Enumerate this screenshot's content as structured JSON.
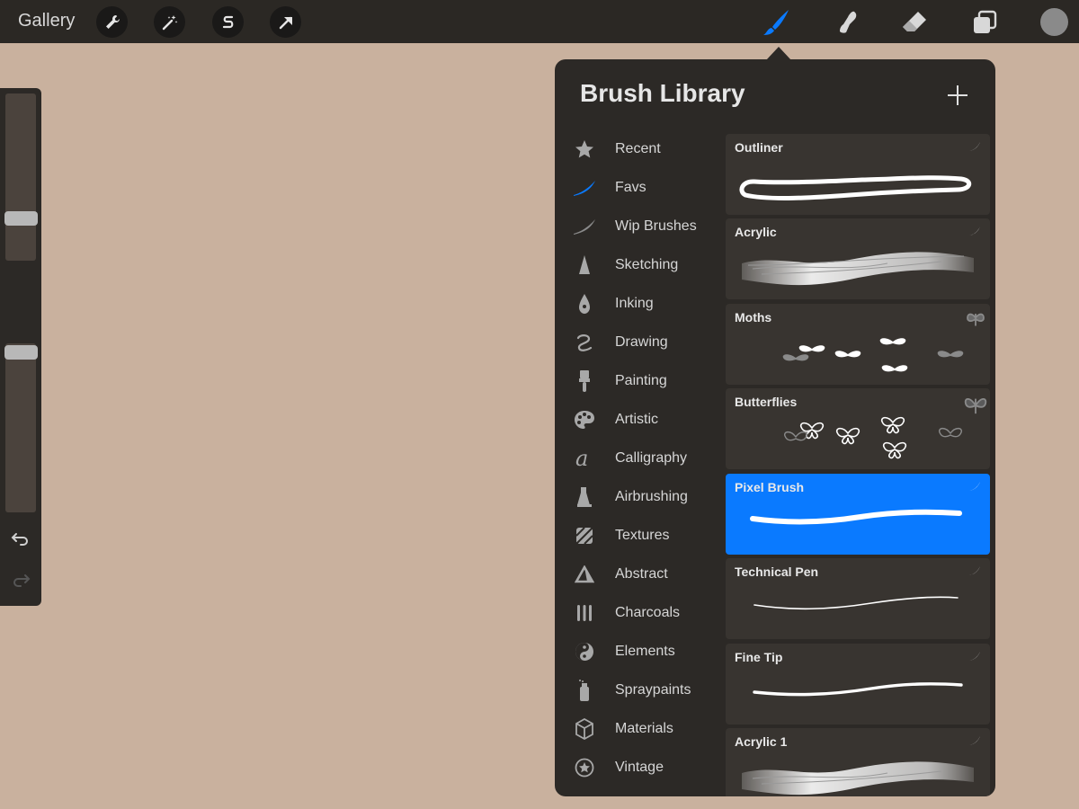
{
  "topbar": {
    "gallery_label": "Gallery",
    "tools": [
      "wrench-icon",
      "magic-wand-icon",
      "selection-icon",
      "transform-arrow-icon"
    ],
    "right_tools": [
      "brush-icon",
      "smudge-icon",
      "eraser-icon",
      "layers-icon"
    ],
    "active_tool": "brush-icon",
    "color_swatch": "#8a8a8a"
  },
  "sidebar": {
    "brush_size_level": 0.75,
    "opacity_level": 0.0,
    "icons": [
      "modifier-square-icon",
      "undo-icon",
      "redo-icon"
    ]
  },
  "brush_library": {
    "title": "Brush Library",
    "add_icon": "plus-icon",
    "categories": [
      {
        "label": "Recent",
        "icon": "star-icon"
      },
      {
        "label": "Favs",
        "icon": "blue-brush-stroke-icon"
      },
      {
        "label": "Wip Brushes",
        "icon": "brush-stroke-icon"
      },
      {
        "label": "Sketching",
        "icon": "pencil-tip-icon"
      },
      {
        "label": "Inking",
        "icon": "pen-nib-icon"
      },
      {
        "label": "Drawing",
        "icon": "squiggle-icon"
      },
      {
        "label": "Painting",
        "icon": "paintbrush-icon"
      },
      {
        "label": "Artistic",
        "icon": "palette-icon"
      },
      {
        "label": "Calligraphy",
        "icon": "calligraphy-a-icon"
      },
      {
        "label": "Airbrushing",
        "icon": "airbrush-icon"
      },
      {
        "label": "Textures",
        "icon": "texture-hatch-icon"
      },
      {
        "label": "Abstract",
        "icon": "triangle-icon"
      },
      {
        "label": "Charcoals",
        "icon": "charcoal-sticks-icon"
      },
      {
        "label": "Elements",
        "icon": "yin-yang-icon"
      },
      {
        "label": "Spraypaints",
        "icon": "spray-can-icon"
      },
      {
        "label": "Materials",
        "icon": "cube-icon"
      },
      {
        "label": "Vintage",
        "icon": "star-badge-icon"
      }
    ],
    "active_category": "Favs",
    "brushes": [
      {
        "name": "Outliner",
        "preview": "outline-stroke"
      },
      {
        "name": "Acrylic",
        "preview": "textured-stroke"
      },
      {
        "name": "Moths",
        "preview": "moth-stamps"
      },
      {
        "name": "Butterflies",
        "preview": "butterfly-stamps"
      },
      {
        "name": "Pixel Brush",
        "preview": "solid-stroke"
      },
      {
        "name": "Technical Pen",
        "preview": "thin-stroke"
      },
      {
        "name": "Fine Tip",
        "preview": "medium-stroke"
      },
      {
        "name": "Acrylic 1",
        "preview": "textured-stroke"
      }
    ],
    "selected_brush": "Pixel Brush",
    "accent_color": "#0a7aff"
  }
}
